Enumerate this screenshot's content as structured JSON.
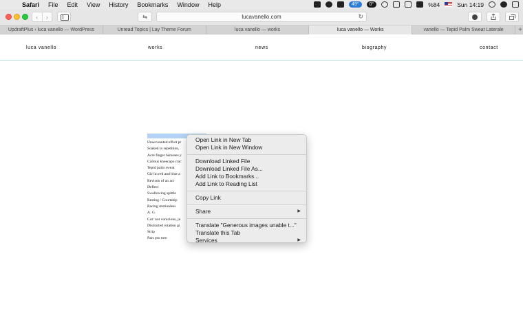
{
  "menubar": {
    "apple": "",
    "items": [
      "Safari",
      "File",
      "Edit",
      "View",
      "History",
      "Bookmarks",
      "Window",
      "Help"
    ],
    "status": {
      "weather": "49°",
      "pill_dark": "0°",
      "battery": "%84",
      "clock": "Sun 14:19"
    }
  },
  "toolbar": {
    "url": "lucavanello.com",
    "back": "‹",
    "forward": "›",
    "reload": "↻",
    "reader": "⇆"
  },
  "tabs": [
    {
      "label": "UpdraftPlus ‹ luca vanello — WordPress",
      "active": false
    },
    {
      "label": "Unread Topics | Lay Theme Forum",
      "active": false
    },
    {
      "label": "luca vanello — works",
      "active": false
    },
    {
      "label": "luca vanello — Works",
      "active": true
    },
    {
      "label": "vanello — Tepid Palm Sweat Laterale",
      "active": false
    }
  ],
  "tab_plus": "+",
  "site": {
    "nav": {
      "home": "luca vanello",
      "works": "works",
      "news": "news",
      "biography": "biography",
      "contact": "contact"
    },
    "works": [
      "Unaccounted effort pr",
      "Soaked in repetition,",
      "Acre finger harasses y",
      "Callous kneecaps crac",
      "Tepid palm sweat",
      "Girl in red and blue a",
      "Revison of an act",
      "Deflect",
      "Swallowing spittle",
      "Resting / Courtship",
      "Racing motionless",
      "A. G.",
      "Cut: not voracious, ju",
      "Distracted rotation gi",
      "Strip",
      "Pars pro toto"
    ]
  },
  "context_menu": {
    "group1": [
      "Open Link in New Tab",
      "Open Link in New Window"
    ],
    "group2": [
      "Download Linked File",
      "Download Linked File As...",
      "Add Link to Bookmarks...",
      "Add Link to Reading List"
    ],
    "group3": [
      "Copy Link"
    ],
    "share": "Share",
    "group5": [
      "Translate \"Generous images unable t...\"",
      "Translate this Tab"
    ],
    "services": "Services",
    "submenu_arrow": "▶"
  }
}
